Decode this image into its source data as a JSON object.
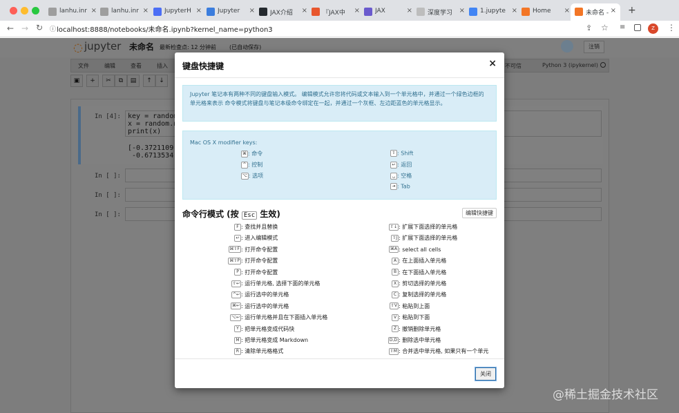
{
  "browser": {
    "tabs": [
      {
        "label": "lanhu.inr",
        "icon": "document-icon",
        "color": "#9e9e9e"
      },
      {
        "label": "lanhu.inr",
        "icon": "document-icon",
        "color": "#9e9e9e"
      },
      {
        "label": "JupyterH",
        "icon": "jupyter-hub-icon",
        "color": "#4c6ef5"
      },
      {
        "label": "Jupyter",
        "icon": "jupyter-icon",
        "color": "#3b7ddd"
      },
      {
        "label": "JAX介绍",
        "icon": "github-icon",
        "color": "#24292e"
      },
      {
        "label": "『JAX中",
        "icon": "csdn-icon",
        "color": "#e8572e"
      },
      {
        "label": "JAX",
        "icon": "jax-icon",
        "color": "#6a5acd"
      },
      {
        "label": "深度学习",
        "icon": "document-icon",
        "color": "#bdbdbd"
      },
      {
        "label": "1.jupyte",
        "icon": "window-icon",
        "color": "#4285f4"
      },
      {
        "label": "Home",
        "icon": "jupyter-home-icon",
        "color": "#f37626"
      },
      {
        "label": "未命名 -",
        "icon": "notebook-icon",
        "color": "#f37626"
      }
    ],
    "new_tab": "+",
    "url": "localhost:8888/notebooks/未命名.ipynb?kernel_name=python3",
    "profile_initial": "Z"
  },
  "notebook": {
    "logo": "jupyter",
    "name": "未命名",
    "checkpoint": "最新检查点: 12 分钟前",
    "autosave": "(已自动保存)",
    "logout": "注销",
    "menus": [
      "文件",
      "编辑",
      "查看",
      "插入"
    ],
    "trusted": "不可信",
    "kernel": "Python 3 (ipykernel)",
    "cells": [
      {
        "prompt": "In [4]:",
        "code": "key = random\nx = random.n\nprint(x)",
        "output": "[-0.3721109\n -0.6713534"
      },
      {
        "prompt": "In [ ]:",
        "code": ""
      },
      {
        "prompt": "In [ ]:",
        "code": ""
      },
      {
        "prompt": "In [ ]:",
        "code": ""
      }
    ]
  },
  "modal": {
    "title": "键盘快捷键",
    "close": "×",
    "info": "Jupyter 笔记本有两种不同的键盘输入模式。 编辑模式允许您将代码或文本输入到一个单元格中，并通过一个绿色边框的单元格来表示 命令模式将键盘与笔记本级命令绑定在一起，并通过一个灰框、左边距蓝色的单元格显示。",
    "mac_title": "Mac OS X modifier keys:",
    "mac_left": [
      {
        "key": "⌘",
        "label": ": 命令"
      },
      {
        "key": "^",
        "label": ": 控制"
      },
      {
        "key": "⌥",
        "label": ": 选项"
      }
    ],
    "mac_right": [
      {
        "key": "⇧",
        "label": ": Shift"
      },
      {
        "key": "↩",
        "label": ": 返回"
      },
      {
        "key": "␣",
        "label": ": 空格"
      },
      {
        "key": "⇥",
        "label": ": Tab"
      }
    ],
    "cmd_title_prefix": "命令行模式 (按",
    "cmd_title_key": "Esc",
    "cmd_title_suffix": "生效)",
    "edit_shortcuts": "编辑快捷键",
    "left_shortcuts": [
      {
        "key": "F",
        "label": ": 查找并且替换"
      },
      {
        "key": "↩",
        "label": ": 进入编辑模式"
      },
      {
        "key": "⌘⇧F",
        "label": ": 打开命令配置"
      },
      {
        "key": "⌘⇧P",
        "label": ": 打开命令配置"
      },
      {
        "key": "P",
        "label": ": 打开命令配置"
      },
      {
        "key": "⇧↩",
        "label": ": 运行单元格, 选择下面的单元格"
      },
      {
        "key": "^↩",
        "label": ": 运行选中的单元格"
      },
      {
        "key": "⌘↩",
        "label": ": 运行选中的单元格"
      },
      {
        "key": "⌥↩",
        "label": ": 运行单元格并且在下面插入单元格"
      },
      {
        "key": "Y",
        "label": ": 把单元格变成代码快"
      },
      {
        "key": "M",
        "label": ": 把单元格变成 Markdown"
      },
      {
        "key": "R",
        "label": ": 清除单元格格式"
      }
    ],
    "right_shortcuts": [
      {
        "key": "⇧↓",
        "label": ": 扩展下面选择的单元格"
      },
      {
        "key": "⇧J",
        "label": ": 扩展下面选择的单元格"
      },
      {
        "key": "⌘A",
        "label": ": select all cells"
      },
      {
        "key": "A",
        "label": ": 在上面插入单元格"
      },
      {
        "key": "B",
        "label": ": 在下面插入单元格"
      },
      {
        "key": "X",
        "label": ": 剪切选择的单元格"
      },
      {
        "key": "C",
        "label": ": 复制选择的单元格"
      },
      {
        "key": "⇧V",
        "label": ": 粘贴到上面"
      },
      {
        "key": "V",
        "label": ": 粘贴到下面"
      },
      {
        "key": "Z",
        "label": ": 撤销删除单元格"
      },
      {
        "key": "D,D",
        "label": ": 删除选中单元格"
      },
      {
        "key": "⇧M",
        "label": ": 合并选中单元格, 如果只有一个单元"
      }
    ],
    "close_button": "关闭"
  },
  "watermark": "@稀土掘金技术社区"
}
